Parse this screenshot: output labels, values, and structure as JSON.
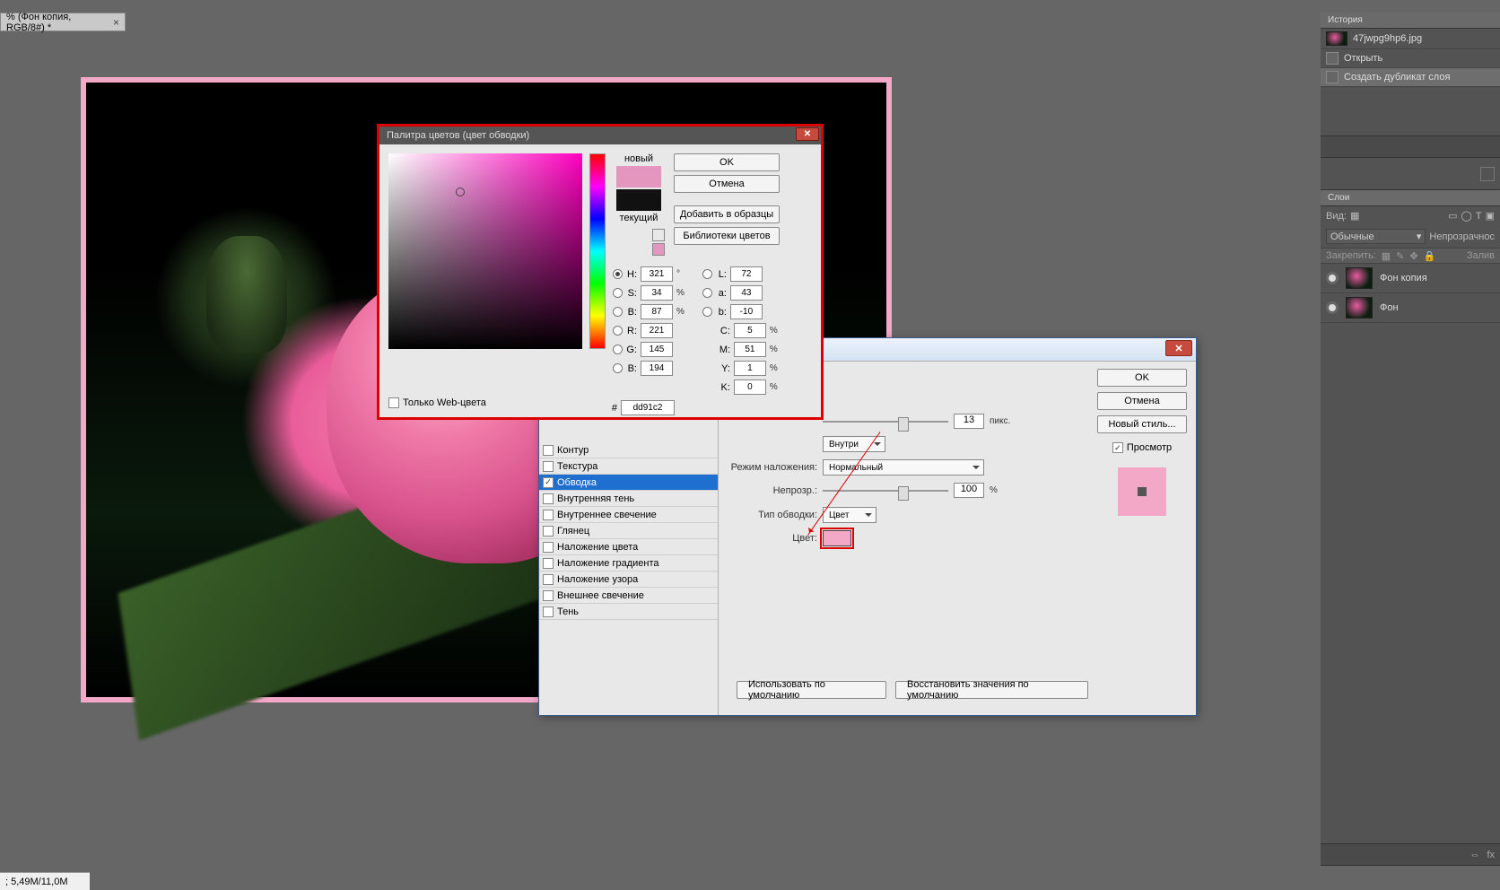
{
  "tab": {
    "title": "% (Фон копия, RGB/8#) *"
  },
  "status": {
    "text": "; 5,49M/11,0M"
  },
  "history": {
    "title": "История",
    "file": "47jwpg9hp6.jpg",
    "steps": [
      "Открыть",
      "Создать дубликат слоя"
    ]
  },
  "layers": {
    "title": "Слои",
    "mode_label": "Вид:",
    "mode": "Обычные",
    "opacity_label": "Непрозрачнос",
    "lock_label": "Закрепить:",
    "fill_label": "Залив",
    "items": [
      "Фон копия",
      "Фон"
    ]
  },
  "layer_style": {
    "options": [
      "Контур",
      "Текстура",
      "Обводка",
      "Внутренняя тень",
      "Внутреннее свечение",
      "Глянец",
      "Наложение цвета",
      "Наложение градиента",
      "Наложение узора",
      "Внешнее свечение",
      "Тень"
    ],
    "size_value": "13",
    "size_unit": "пикс.",
    "position_value": "Внутри",
    "blend_label": "Режим наложения:",
    "blend_value": "Нормальный",
    "opacity_label": "Непрозр.:",
    "opacity_value": "100",
    "opacity_unit": "%",
    "filltype_label": "Тип обводки:",
    "filltype_value": "Цвет",
    "color_label": "Цвет:",
    "default_btn": "Использовать по умолчанию",
    "reset_btn": "Восстановить значения по умолчанию",
    "ok": "OK",
    "cancel": "Отмена",
    "newstyle": "Новый стиль...",
    "preview": "Просмотр"
  },
  "color_picker": {
    "title": "Палитра цветов (цвет обводки)",
    "new_label": "новый",
    "current_label": "текущий",
    "ok": "OK",
    "cancel": "Отмена",
    "swatches": "Добавить в образцы",
    "libraries": "Библиотеки цветов",
    "webonly": "Только Web-цвета",
    "H": "321",
    "S": "34",
    "Bval": "87",
    "R": "221",
    "G": "145",
    "Bblue": "194",
    "L": "72",
    "a": "43",
    "bsm": "-10",
    "C": "5",
    "M": "51",
    "Y": "1",
    "K": "0",
    "degree": "°",
    "pct": "%",
    "hex": "dd91c2",
    "labels": {
      "H": "H:",
      "S": "S:",
      "B": "B:",
      "R": "R:",
      "G": "G:",
      "Bb": "B:",
      "L": "L:",
      "a": "a:",
      "b": "b:",
      "C": "C:",
      "M": "M:",
      "Y": "Y:",
      "K": "K:",
      "hash": "#"
    }
  }
}
